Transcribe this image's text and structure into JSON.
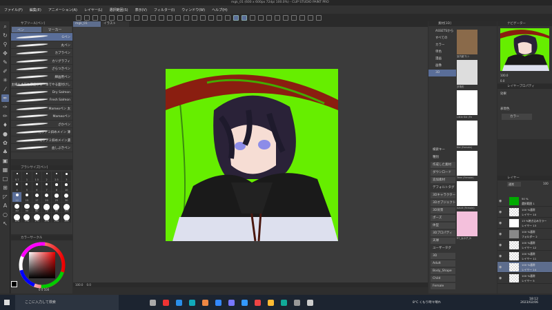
{
  "window": {
    "title": "mgk_01 (600 x 600px 72dpi 100.0%) - CLIP STUDIO PAINT PRO"
  },
  "menu": [
    "ファイル(F)",
    "編集(E)",
    "アニメーション(A)",
    "レイヤー(L)",
    "選択範囲(S)",
    "表示(V)",
    "フィルター(I)",
    "ウィンドウ(W)",
    "ヘルプ(H)"
  ],
  "doc_tabs": [
    "mgk_01",
    "イラスト"
  ],
  "subtool": {
    "panel_title": "サブツール[ペン]",
    "tabs": [
      "ペン",
      "マーカー"
    ],
    "brushes": [
      "Gペン",
      "丸ペン",
      "カブラペン",
      "カリグラフィ",
      "ざらつきペン",
      "綿画用ペン",
      "主線も水彩も厚塗りも一本でやる面付けし",
      "Dry Salmon",
      "Fresh Salmon",
      "Mameoペン 太",
      "Mameoペン",
      "ざかペン",
      "カケアミ斜めメイン 薄",
      "カケアミ斜めメイン濃",
      "血しぶきペン"
    ]
  },
  "brush_size": {
    "panel_title": "ブラシサイズ[ペン]",
    "sizes": [
      "0.7",
      "1",
      "1.5",
      "2",
      "2.5",
      "3",
      "4",
      "5",
      "6",
      "7",
      "8",
      "10",
      "12",
      "15",
      "17",
      "20",
      "25",
      "30",
      "40",
      "50",
      "60",
      "70",
      "80",
      "100",
      "120",
      "150",
      "170",
      "200",
      "250",
      "300"
    ],
    "selected": "12"
  },
  "color": {
    "panel_title": "カラーサークル",
    "main": "#000000",
    "readout": "0 0 100"
  },
  "status": {
    "zoom": "100.0",
    "angle": "0.0"
  },
  "material": {
    "panel_title": "素材[3D]",
    "tree": [
      "ASSETSから",
      "すべての",
      "カラー",
      "単色",
      "漫画",
      "画像",
      "3D"
    ],
    "selected": "3D",
    "items": [
      "室内廊下(ト",
      "多角形",
      "Little Kid (Fe",
      "Kid (Female)",
      "Teen (Female)",
      "Adult (Female)",
      "RT_女の子_B"
    ],
    "search_label": "検索キー",
    "tags": [
      "種別",
      "作成した素材",
      "ダウンロード",
      "追加素材",
      "デフォルトタグ",
      "3Dキャラクター",
      "3Dオブジェクト",
      "3D背景",
      "ポーズ",
      "体型",
      "3Dプロパティ",
      "天球",
      "ユーザータグ",
      "3D",
      "Adult",
      "Body_Shape",
      "Child",
      "Female"
    ]
  },
  "navigator": {
    "panel_title": "ナビゲーター",
    "zoom": "100.0",
    "angle": "0.0"
  },
  "layer_property": {
    "panel_title": "レイヤープロパティ",
    "effect_label": "効果",
    "color_label": "表現色",
    "color_value": "カラー"
  },
  "layers": {
    "panel_title": "レイヤー",
    "blend": "通常",
    "opacity": "100",
    "rows": [
      {
        "mode": "50 %",
        "name": "選択範囲 1"
      },
      {
        "mode": "100 %通常",
        "name": "レイヤー 10"
      },
      {
        "mode": "13 %焼き込みカラー",
        "name": "レイヤー 13"
      },
      {
        "mode": "100 %通常",
        "name": "フォルダー 2"
      },
      {
        "mode": "100 %通常",
        "name": "レイヤー 12"
      },
      {
        "mode": "100 %通常",
        "name": "レイヤー 11"
      },
      {
        "mode": "100 %通常",
        "name": "レイヤー 14"
      },
      {
        "mode": "100 %通常",
        "name": "レイヤー 5"
      }
    ],
    "selected": 6
  },
  "taskbar": {
    "search_placeholder": "ここに入力して検索",
    "weather": "8°C くもり時々晴れ",
    "time": "18:12",
    "date": "2023/02/06"
  },
  "colors": {
    "canvas_bg": "#66ee00",
    "accent": "#5a6e99"
  }
}
